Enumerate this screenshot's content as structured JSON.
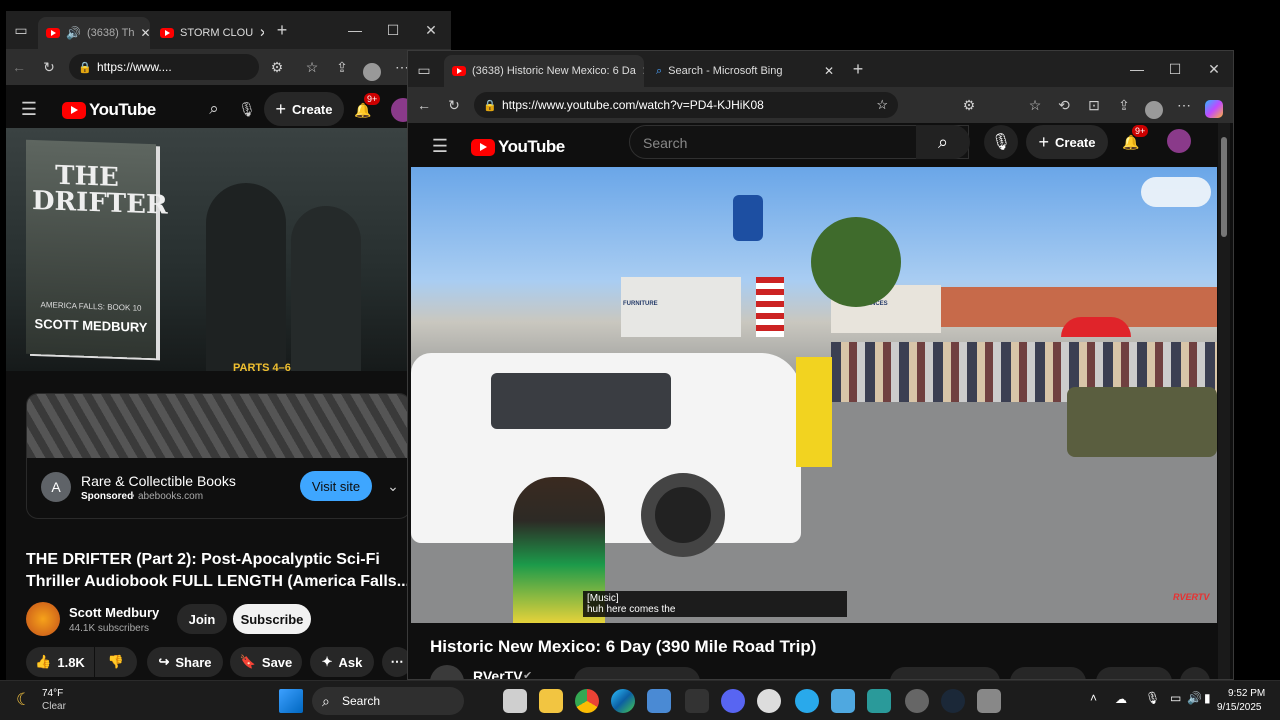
{
  "left_window": {
    "tabs": [
      {
        "label": "(3638) Th"
      },
      {
        "label": "STORM CLOU"
      }
    ],
    "url": "https://www....",
    "youtube": {
      "logo_text": "YouTube",
      "create_label": "Create",
      "notif_badge": "9+"
    },
    "thumbnail": {
      "book_title": "THE DRIFTER",
      "book_series": "AMERICA FALLS: BOOK 10",
      "book_author": "SCOTT MEDBURY",
      "parts_label": "PARTS 4–6"
    },
    "ad": {
      "avatar_letter": "A",
      "title": "Rare & Collectible Books",
      "sponsored": "Sponsored",
      "domain": "abebooks.com",
      "button": "Visit site"
    },
    "video": {
      "title": "THE DRIFTER (Part 2): Post-Apocalyptic Sci-Fi Thriller Audiobook FULL LENGTH (America Falls...",
      "channel": "Scott Medbury",
      "subscribers": "44.1K subscribers",
      "join": "Join",
      "subscribe": "Subscribe",
      "likes": "1.8K",
      "share": "Share",
      "save": "Save",
      "ask": "Ask"
    }
  },
  "right_window": {
    "tabs": [
      {
        "label": "(3638) Historic New Mexico: 6 Da"
      },
      {
        "label": "Search - Microsoft Bing"
      }
    ],
    "url": "https://www.youtube.com/watch?v=PD4-KJHiK08",
    "youtube": {
      "logo_text": "YouTube",
      "search_placeholder": "Search",
      "create_label": "Create",
      "notif_badge": "9+"
    },
    "video": {
      "caption_line1": "[Music]",
      "caption_line2": "huh here comes the",
      "watermark": "RVERTV",
      "title": "Historic New Mexico: 6 Day (390 Mile Road Trip)",
      "channel": "RVerTV",
      "scene_signs": {
        "furniture": "FURNITURE",
        "appliances": "APPLIANCES"
      }
    }
  },
  "taskbar": {
    "weather_temp": "74°F",
    "weather_desc": "Clear",
    "search_label": "Search",
    "time": "9:52 PM",
    "date": "9/15/2025"
  },
  "colors": {
    "youtube_red": "#ff0000",
    "visit_blue": "#3ea6ff",
    "bg_dark": "#0f0f0f"
  }
}
